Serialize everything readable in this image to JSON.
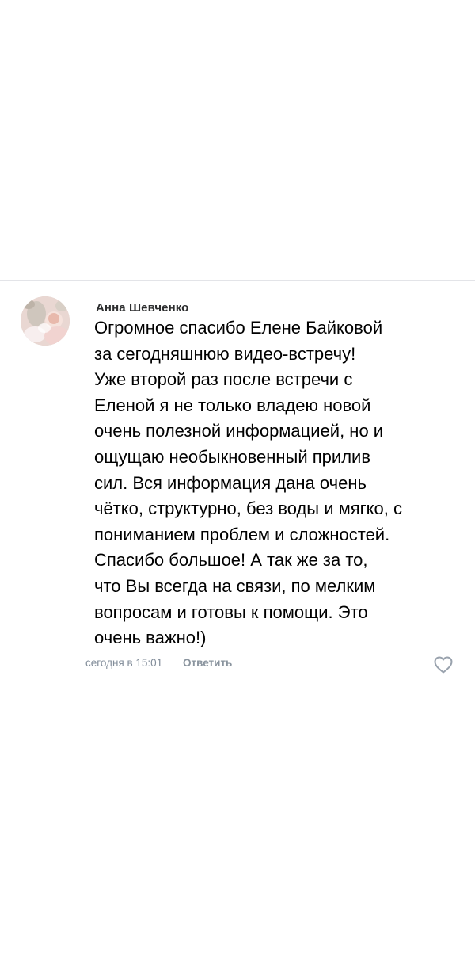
{
  "comment": {
    "author": "Анна Шевченко",
    "text_lines": [
      "Огромное спасибо Елене Байковой",
      "за сегодняшнюю видео-встречу!",
      "Уже второй раз после встречи с",
      "Еленой я не только владею новой",
      "очень полезной информацией, но и",
      "ощущаю необыкновенный прилив",
      "сил.  Вся информация дана очень",
      "чётко,  структурно, без воды и мягко,  с",
      "пониманием проблем и сложностей.",
      "Спасибо большое! А так же за то,",
      "что Вы всегда на связи, по мелким",
      "вопросам и готовы к помощи. Это",
      "очень важно!)"
    ],
    "time": "сегодня в 15:01",
    "reply_label": "Ответить",
    "avatar_icon": "avatar-photo",
    "like_icon": "heart-outline-icon"
  },
  "colors": {
    "divider": "#e3e4e8",
    "meta_text": "#818c99",
    "body_text": "#000000"
  }
}
